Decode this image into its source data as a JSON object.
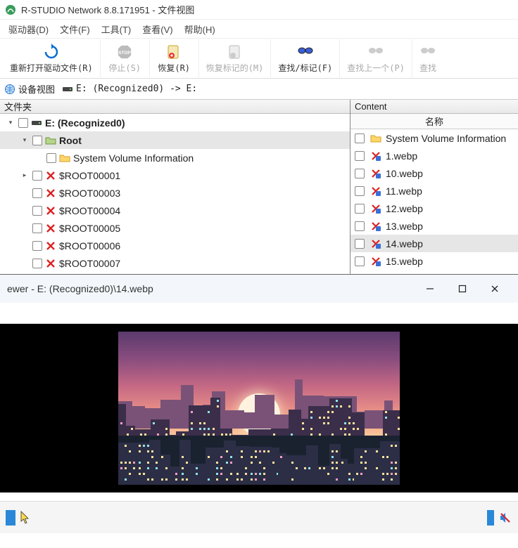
{
  "titlebar": {
    "title": "R-STUDIO Network 8.8.171951 - 文件视图"
  },
  "menubar": {
    "items": [
      "驱动器(D)",
      "文件(F)",
      "工具(T)",
      "查看(V)",
      "帮助(H)"
    ]
  },
  "toolbar": {
    "items": [
      {
        "label": "重新打开驱动文件(R)",
        "icon": "refresh-icon",
        "enabled": true
      },
      {
        "label": "停止(S)",
        "icon": "stop-icon",
        "enabled": false
      },
      {
        "label": "恢复(R)",
        "icon": "recover-icon",
        "enabled": true
      },
      {
        "label": "恢复标记的(M)",
        "icon": "recover-marked-icon",
        "enabled": false
      },
      {
        "label": "查找/标记(F)",
        "icon": "find-icon",
        "enabled": true
      },
      {
        "label": "查找上一个(P)",
        "icon": "find-prev-icon",
        "enabled": false
      },
      {
        "label": "查找",
        "icon": "find-next-icon",
        "enabled": false
      }
    ]
  },
  "pathbar": {
    "device_view": "设备视图",
    "path": "E: (Recognized0) -> E:"
  },
  "left_panel": {
    "header": "文件夹",
    "tree": [
      {
        "level": 0,
        "expander": "down",
        "chk": true,
        "icon": "drive-icon",
        "label": "E: (Recognized0)",
        "bold": true,
        "selected": false
      },
      {
        "level": 1,
        "expander": "down",
        "chk": true,
        "icon": "folder-green-icon",
        "label": "Root",
        "bold": true,
        "selected": true
      },
      {
        "level": 2,
        "expander": "none",
        "chk": true,
        "icon": "folder-yellow-icon",
        "label": "System Volume Information",
        "bold": false,
        "selected": false
      },
      {
        "level": 1,
        "expander": "right",
        "chk": true,
        "icon": "x-red-icon",
        "label": "$ROOT00001",
        "bold": false,
        "selected": false
      },
      {
        "level": 1,
        "expander": "none-indent",
        "chk": true,
        "icon": "x-red-icon",
        "label": "$ROOT00003",
        "bold": false,
        "selected": false
      },
      {
        "level": 1,
        "expander": "none-indent",
        "chk": true,
        "icon": "x-red-icon",
        "label": "$ROOT00004",
        "bold": false,
        "selected": false
      },
      {
        "level": 1,
        "expander": "none-indent",
        "chk": true,
        "icon": "x-red-icon",
        "label": "$ROOT00005",
        "bold": false,
        "selected": false
      },
      {
        "level": 1,
        "expander": "none-indent",
        "chk": true,
        "icon": "x-red-icon",
        "label": "$ROOT00006",
        "bold": false,
        "selected": false
      },
      {
        "level": 1,
        "expander": "none-indent",
        "chk": true,
        "icon": "x-red-icon",
        "label": "$ROOT00007",
        "bold": false,
        "selected": false
      }
    ]
  },
  "right_panel": {
    "header": "Content",
    "col_header": "名称",
    "files": [
      {
        "icon": "folder-yellow-icon",
        "label": "System Volume Information",
        "selected": false
      },
      {
        "icon": "x-blue-icon",
        "label": "1.webp",
        "selected": false
      },
      {
        "icon": "x-blue-icon",
        "label": "10.webp",
        "selected": false
      },
      {
        "icon": "x-blue-icon",
        "label": "11.webp",
        "selected": false
      },
      {
        "icon": "x-blue-icon",
        "label": "12.webp",
        "selected": false
      },
      {
        "icon": "x-blue-icon",
        "label": "13.webp",
        "selected": false
      },
      {
        "icon": "x-blue-icon",
        "label": "14.webp",
        "selected": true
      },
      {
        "icon": "x-blue-icon",
        "label": "15.webp",
        "selected": false
      }
    ]
  },
  "viewer": {
    "title": "ewer - E: (Recognized0)\\14.webp"
  }
}
